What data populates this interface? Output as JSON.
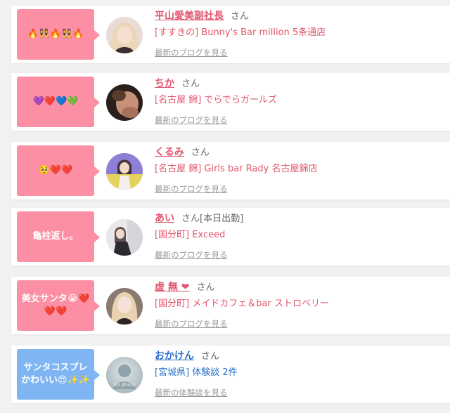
{
  "entries": [
    {
      "message": "🔥👯🔥👯🔥",
      "name": "平山愛美副社長",
      "suffix": "さん",
      "shop": "[すすきの] Bunny's Bar million 5条通店",
      "link": "最新のブログを見る",
      "theme": "pink"
    },
    {
      "message": "💜❤️💙💚",
      "name": "ちか",
      "suffix": "さん",
      "shop": "[名古屋 錦] でらでらガールズ",
      "link": "最新のブログを見る",
      "theme": "pink"
    },
    {
      "message": "🥺❤️❤️",
      "name": "くるみ",
      "suffix": "さん",
      "shop": "[名古屋 錦] Girls bar Rady 名古屋錦店",
      "link": "最新のブログを見る",
      "theme": "pink"
    },
    {
      "message": "亀柱返し。",
      "name": "あい",
      "suffix": "さん[本日出勤]",
      "shop": "[国分町] Exceed",
      "link": "最新のブログを見る",
      "theme": "pink"
    },
    {
      "message": "美女サンタ😭❤️❤️❤️",
      "name": "虚 無 ❤",
      "suffix": "さん",
      "shop": "[国分町] メイドカフェ＆bar ストロベリー",
      "link": "最新のブログを見る",
      "theme": "pink"
    },
    {
      "message": "サンタコスプレかわいい😍✨✨",
      "name": "おかけん",
      "suffix": "さん",
      "shop": "[宮城県] 体験談 2件",
      "link": "最新の体験談を見る",
      "avatar_text": "no photo",
      "theme": "blue"
    }
  ],
  "colors": {
    "pink_bubble": "#fc8fa3",
    "blue_bubble": "#7fb5f3",
    "pink_text": "#e2556d",
    "blue_text": "#2a6fc9"
  }
}
